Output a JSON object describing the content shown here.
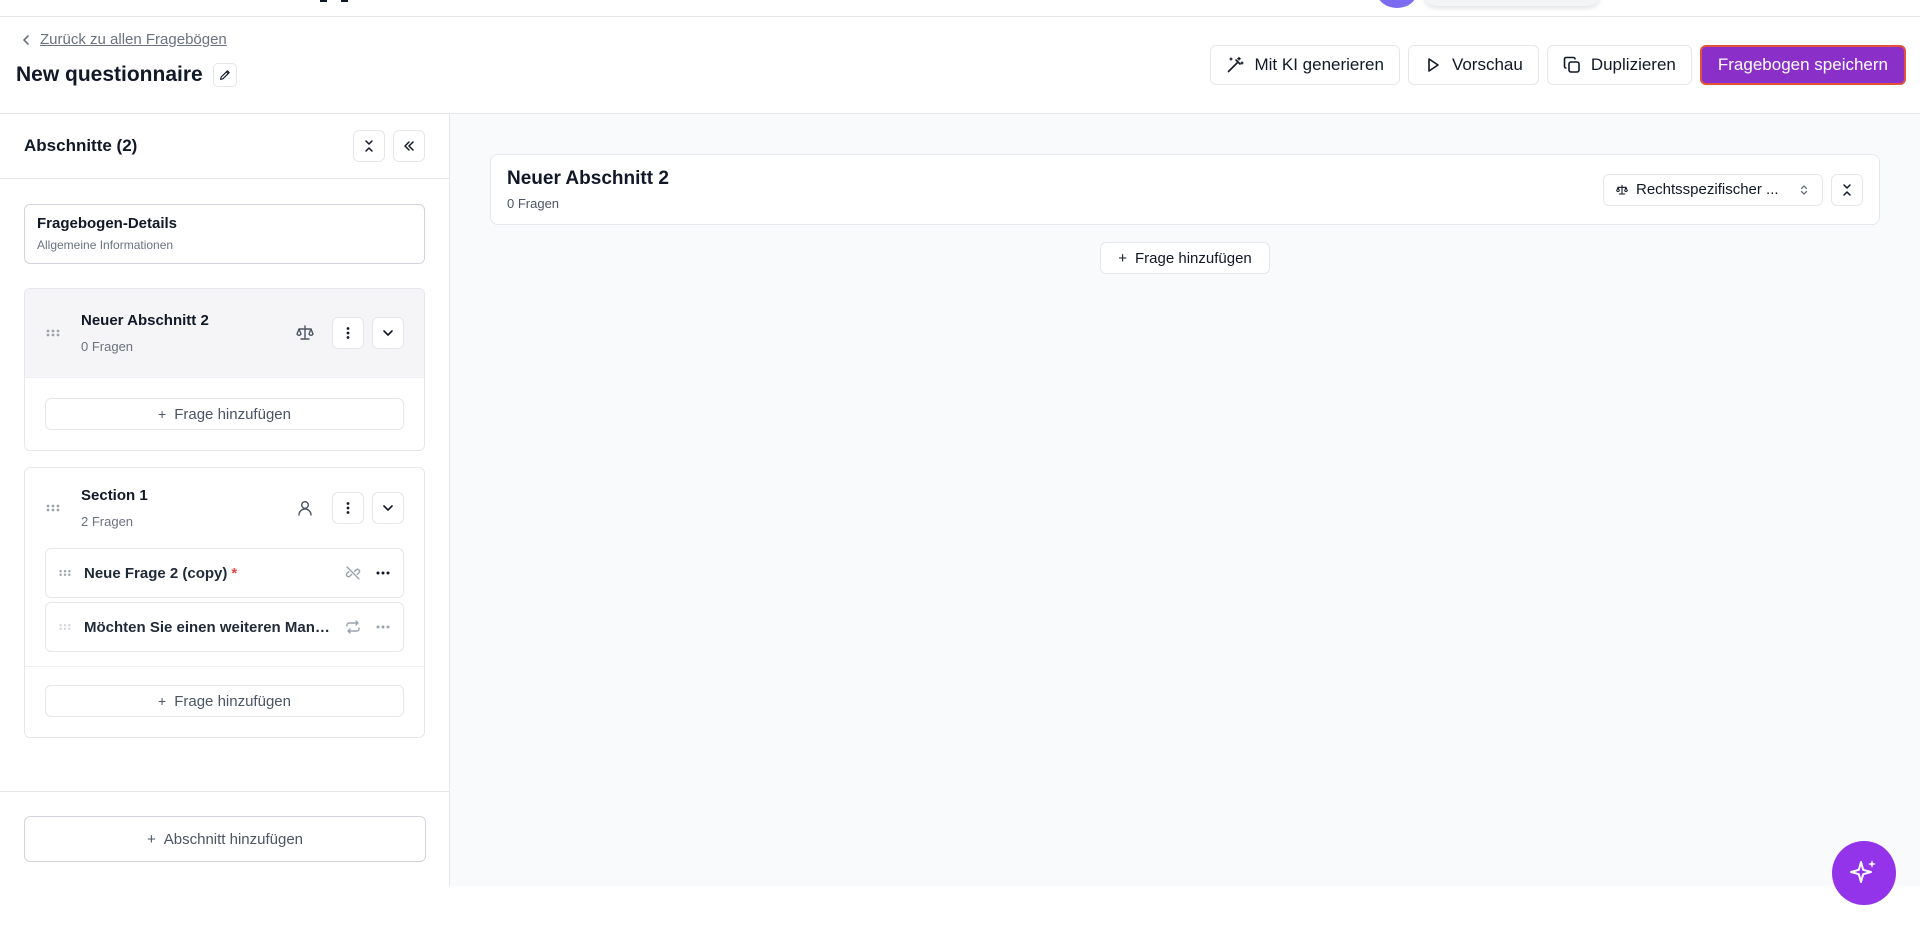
{
  "header": {
    "back_label": "Zurück zu allen Fragebögen",
    "title": "New questionnaire",
    "actions": {
      "ai_generate": "Mit KI generieren",
      "preview": "Vorschau",
      "duplicate": "Duplizieren",
      "save": "Fragebogen speichern"
    }
  },
  "sidebar": {
    "title": "Abschnitte (2)",
    "details": {
      "title": "Fragebogen-Details",
      "subtitle": "Allgemeine Informationen"
    },
    "sections": [
      {
        "name": "Neuer Abschnitt 2",
        "count": "0 Fragen",
        "icon": "scale-icon",
        "add_question": "Frage hinzufügen",
        "questions": []
      },
      {
        "name": "Section 1",
        "count": "2 Fragen",
        "icon": "user-icon",
        "add_question": "Frage hinzufügen",
        "questions": [
          {
            "text": "Neue Frage 2 (copy)",
            "required_mark": "*",
            "icon": "unlink-icon"
          },
          {
            "text": "Möchten Sie einen weiteren Mandanten hinzufügen?",
            "icon": "repeat-icon"
          }
        ]
      }
    ],
    "add_section": "Abschnitt hinzufügen"
  },
  "main": {
    "section_title": "Neuer Abschnitt 2",
    "section_count": "0 Fragen",
    "type_select_value": "Rechtsspezifischer ...",
    "add_question": "Frage hinzufügen"
  },
  "colors": {
    "primary": "#8b2fc9",
    "fab": "#9333ea",
    "required": "#ef4444"
  }
}
